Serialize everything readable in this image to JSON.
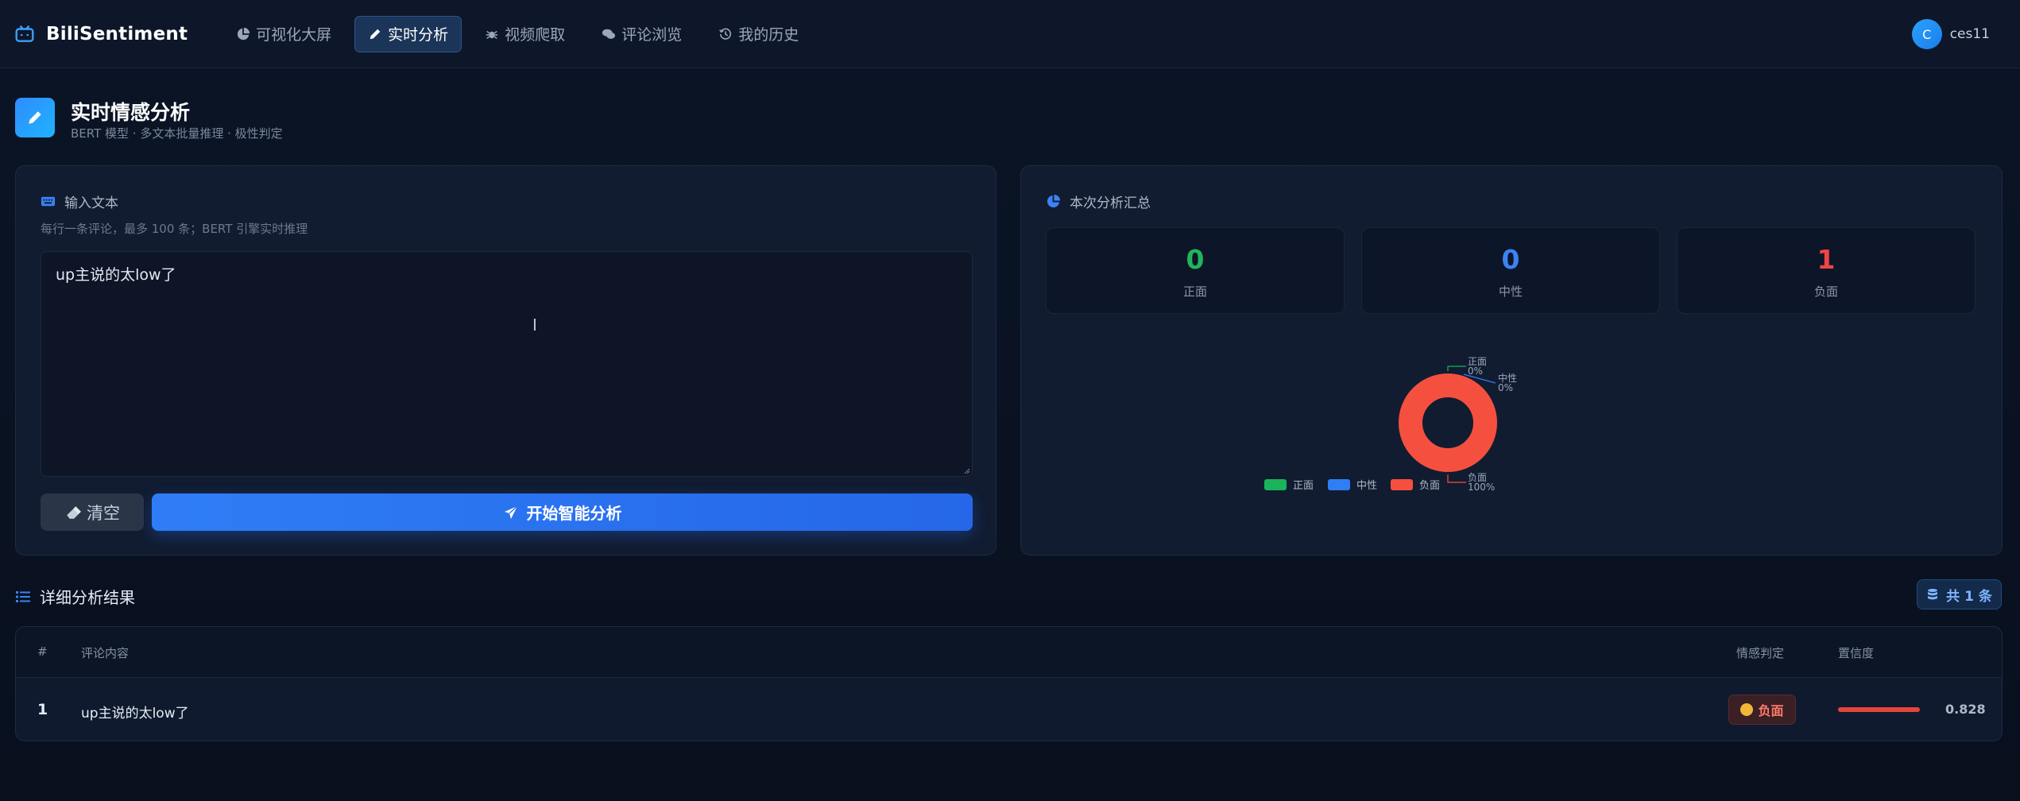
{
  "app": {
    "brand": "BiliSentiment"
  },
  "nav": {
    "items": [
      {
        "label": "可视化大屏",
        "icon": "pie-chart-icon",
        "active": false
      },
      {
        "label": "实时分析",
        "icon": "pencil-icon",
        "active": true
      },
      {
        "label": "视频爬取",
        "icon": "spider-icon",
        "active": false
      },
      {
        "label": "评论浏览",
        "icon": "comments-icon",
        "active": false
      },
      {
        "label": "我的历史",
        "icon": "history-icon",
        "active": false
      }
    ]
  },
  "user": {
    "initial": "C",
    "name": "ces11"
  },
  "page": {
    "title": "实时情感分析",
    "subtitle": "BERT 模型 · 多文本批量推理 · 极性判定"
  },
  "input_card": {
    "title": "输入文本",
    "hint": "每行一条评论，最多 100 条；BERT 引擎实时推理",
    "text": "up主说的太low了",
    "cursor_glyph": "I",
    "clear_label": "清空",
    "analyze_label": "开始智能分析"
  },
  "summary_card": {
    "title": "本次分析汇总",
    "stats": [
      {
        "value": "0",
        "label": "正面",
        "color": "#22b45a"
      },
      {
        "value": "0",
        "label": "中性",
        "color": "#3b82f6"
      },
      {
        "value": "1",
        "label": "负面",
        "color": "#ef4444"
      }
    ]
  },
  "chart_data": {
    "type": "pie",
    "donut": true,
    "categories": [
      "正面",
      "中性",
      "负面"
    ],
    "values": [
      0,
      0,
      1
    ],
    "percent_labels": [
      "0%",
      "0%",
      "100%"
    ],
    "colors": [
      "#19b35b",
      "#2f7ef6",
      "#f5503f"
    ],
    "legend": "bottom"
  },
  "results": {
    "title": "详细分析结果",
    "count_label": "共 1 条",
    "columns": [
      "#",
      "评论内容",
      "情感判定",
      "置信度"
    ],
    "rows": [
      {
        "index": "1",
        "text": "up主说的太low了",
        "sentiment": "负面",
        "confidence": "0.828",
        "confidence_value": 0.828
      }
    ]
  },
  "colors": {
    "accent": "#2f7df6",
    "negative": "#ef4444",
    "positive": "#22b45a",
    "neutral": "#3b82f6"
  }
}
